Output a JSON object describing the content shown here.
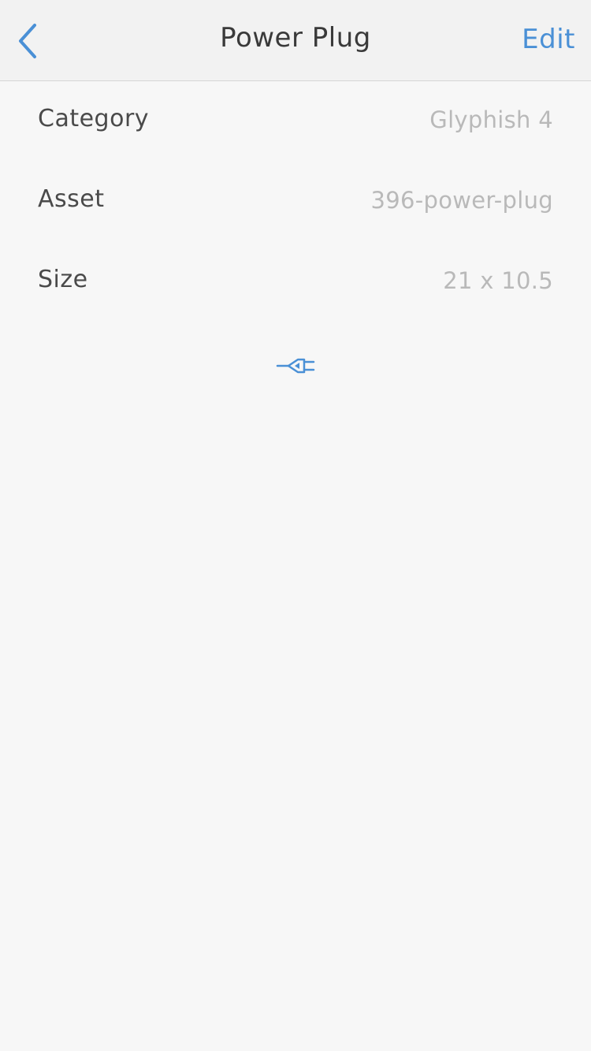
{
  "navbar": {
    "title": "Power Plug",
    "edit_label": "Edit",
    "back_icon": "chevron-left-icon"
  },
  "details": {
    "rows": [
      {
        "label": "Category",
        "value": "Glyphish 4"
      },
      {
        "label": "Asset",
        "value": "396-power-plug"
      },
      {
        "label": "Size",
        "value": "21 x 10.5"
      }
    ]
  },
  "preview": {
    "icon": "power-plug-icon",
    "color": "#4a90d6"
  },
  "colors": {
    "accent": "#4a90d6",
    "label": "#4a4a4a",
    "value": "#b9b9b9"
  }
}
